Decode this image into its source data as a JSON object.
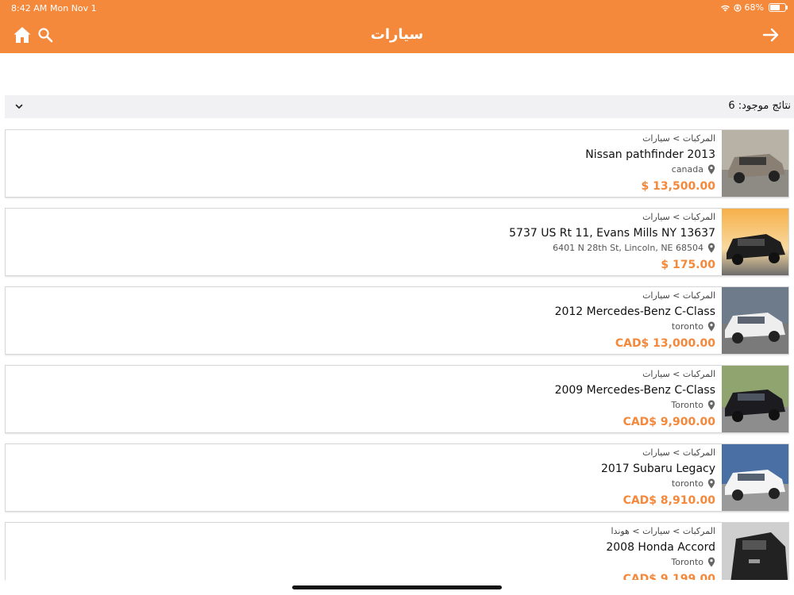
{
  "status_bar": {
    "time": "8:42 AM",
    "date": "Mon Nov 1",
    "battery": "68%",
    "battery_level": 0.68
  },
  "header": {
    "title": "سيارات",
    "icons": [
      "home-icon",
      "search-icon",
      "arrow-right-icon"
    ]
  },
  "filter": {
    "count_label": "نتائج موجود: 6"
  },
  "listings": [
    {
      "breadcrumb": "المركبات > سيارات",
      "title": "Nissan pathfinder 2013",
      "location": "canada",
      "price": "$ 13,500.00",
      "thumb_color": "#8a7f73"
    },
    {
      "breadcrumb": "المركبات > سيارات",
      "title": "5737 US Rt 11, Evans Mills NY 13637",
      "location": "6401 N 28th St, Lincoln, NE 68504",
      "price": "$ 175.00",
      "thumb_color": "#2a2a2a"
    },
    {
      "breadcrumb": "المركبات > سيارات",
      "title": "2012 Mercedes-Benz C-Class",
      "location": "toronto",
      "price": "CAD$ 13,000.00",
      "thumb_color": "#e8e8e8"
    },
    {
      "breadcrumb": "المركبات > سيارات",
      "title": "2009 Mercedes-Benz C-Class",
      "location": "Toronto",
      "price": "CAD$ 9,900.00",
      "thumb_color": "#1c1c20"
    },
    {
      "breadcrumb": "المركبات > سيارات",
      "title": "2017 Subaru Legacy",
      "location": "toronto",
      "price": "CAD$ 8,910.00",
      "thumb_color": "#f2f2f2"
    },
    {
      "breadcrumb": "المركبات > سيارات > هوندا",
      "title": "2008 Honda Accord",
      "location": "Toronto",
      "price": "CAD$ 9,199.00",
      "thumb_color": "#222222"
    }
  ],
  "colors": {
    "accent": "#F4883B",
    "filter_bg": "#f1f1f3"
  }
}
